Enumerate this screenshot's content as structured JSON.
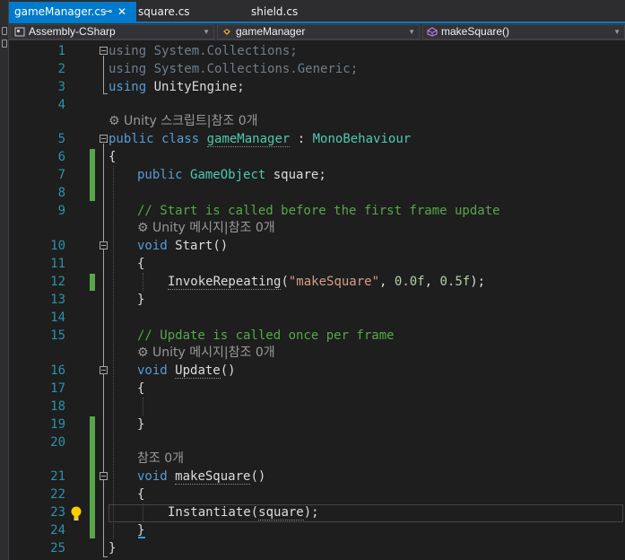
{
  "tabs": [
    {
      "label": "gameManager.cs",
      "active": true,
      "pin": "⊸",
      "close": "✕"
    },
    {
      "label": "square.cs",
      "active": false
    },
    {
      "label": "shield.cs",
      "active": false
    }
  ],
  "navbar": {
    "project": "Assembly-CSharp",
    "class": "gameManager",
    "member": "makeSquare()"
  },
  "line_numbers": [
    "1",
    "2",
    "3",
    "4",
    "5",
    "6",
    "7",
    "8",
    "9",
    "10",
    "11",
    "12",
    "13",
    "14",
    "15",
    "16",
    "17",
    "18",
    "19",
    "20",
    "21",
    "22",
    "23",
    "24",
    "25"
  ],
  "code": {
    "l1": {
      "kw": "using",
      "rest": " System.Collections;"
    },
    "l2": {
      "kw": "using",
      "rest": " System.Collections.Generic;"
    },
    "l3": {
      "kw": "using",
      "rest": " UnityEngine;"
    },
    "lens_class": "Unity 스크립트|참조 0개",
    "l5": {
      "kw1": "public",
      "kw2": " class ",
      "name": "gameManager",
      "sep": " : ",
      "base": "MonoBehaviour"
    },
    "l6": "{",
    "l7": {
      "kw": "public",
      "type": "GameObject",
      "rest": " square;"
    },
    "l9": "// Start is called before the first frame update",
    "lens_start": "Unity 메시지|참조 0개",
    "l10": {
      "kw": "void",
      "name": "Start",
      "rest": "()"
    },
    "l11": "{",
    "l12": {
      "call": "InvokeRepeating",
      "open": "(",
      "str": "\"makeSquare\"",
      "sep1": ", ",
      "n1": "0.0f",
      "sep2": ", ",
      "n2": "0.5f",
      "close": ");"
    },
    "l13": "}",
    "l15": "// Update is called once per frame",
    "lens_update": "Unity 메시지|참조 0개",
    "l16": {
      "kw": "void",
      "name": "Update",
      "rest": "()"
    },
    "l17": "{",
    "l19": "}",
    "lens_make": "참조 0개",
    "l21": {
      "kw": "void",
      "name": "makeSquare",
      "rest": "()"
    },
    "l22": "{",
    "l23": {
      "call": "Instantiate",
      "open": "(",
      "arg": "square",
      "close": ");"
    },
    "l24": "}",
    "l25": "}"
  },
  "colors": {
    "accent": "#007acc",
    "keyword": "#569cd6",
    "type": "#4ec9b0",
    "comment": "#57a64a",
    "string": "#d69d85",
    "line_number": "#2b91af"
  },
  "icons": [
    "unity-icon",
    "lightbulb-icon",
    "fold-icon",
    "project-icon",
    "class-icon",
    "method-icon"
  ]
}
